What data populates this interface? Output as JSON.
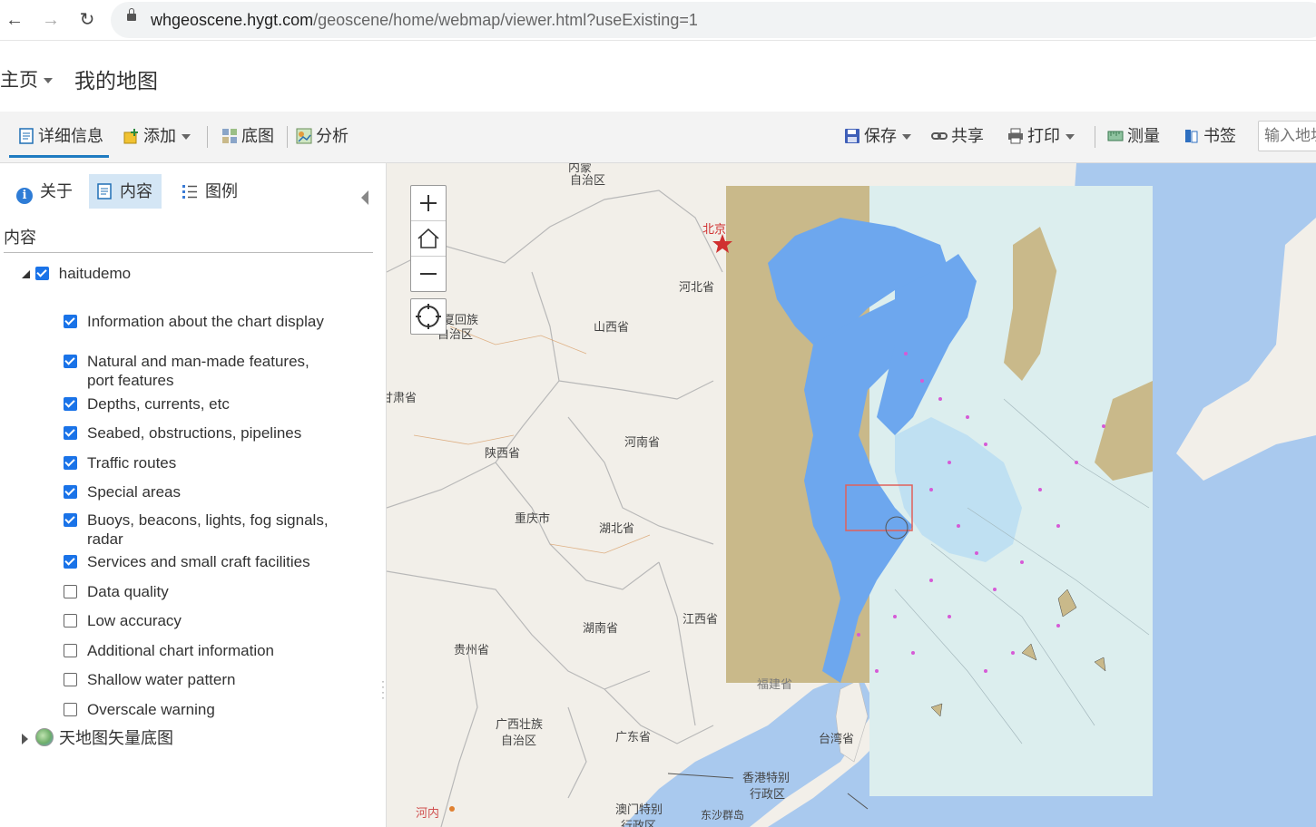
{
  "browser": {
    "url_host": "whgeoscene.hygt.com",
    "url_path": "/geoscene/home/webmap/viewer.html?useExisting=1"
  },
  "header": {
    "home_label": "主页",
    "map_title": "我的地图"
  },
  "toolbar": {
    "details": "详细信息",
    "add": "添加",
    "basemap": "底图",
    "analysis": "分析",
    "save": "保存",
    "share": "共享",
    "print": "打印",
    "measure": "测量",
    "bookmarks": "书签",
    "search_placeholder": "输入地址"
  },
  "panel": {
    "tab_about": "关于",
    "tab_content": "内容",
    "tab_legend": "图例",
    "content_heading": "内容",
    "root_layer": "haitudemo",
    "sublayers": [
      {
        "label": "Information about the chart display",
        "checked": true
      },
      {
        "label": "Natural and man-made features, port features",
        "checked": true
      },
      {
        "label": "Depths, currents, etc",
        "checked": true
      },
      {
        "label": "Seabed, obstructions, pipelines",
        "checked": true
      },
      {
        "label": "Traffic routes",
        "checked": true
      },
      {
        "label": "Special areas",
        "checked": true
      },
      {
        "label": "Buoys, beacons, lights, fog signals, radar",
        "checked": true
      },
      {
        "label": "Services and small craft facilities",
        "checked": true
      },
      {
        "label": "Data quality",
        "checked": false
      },
      {
        "label": "Low accuracy",
        "checked": false
      },
      {
        "label": "Additional chart information",
        "checked": false
      },
      {
        "label": "Shallow water pattern",
        "checked": false
      },
      {
        "label": "Overscale warning",
        "checked": false
      }
    ],
    "basemap_layer": "天地图矢量底图"
  },
  "map": {
    "labels": {
      "inner_mongolia": "自治区",
      "inner_mongolia_top": "内蒙",
      "beijing": "北京",
      "hebei": "河北省",
      "shanxi": "山西省",
      "ningxia_1": "夏回族",
      "ningxia_2": "自治区",
      "gansu": "甘肃省",
      "shaanxi": "陕西省",
      "henan": "河南省",
      "chongqing": "重庆市",
      "hubei": "湖北省",
      "hunan": "湖南省",
      "jiangxi": "江西省",
      "guizhou": "贵州省",
      "guangxi_1": "广西壮族",
      "guangxi_2": "自治区",
      "guangdong": "广东省",
      "taiwan": "台湾省",
      "hongkong_1": "香港特别",
      "hongkong_2": "行政区",
      "macau_1": "澳门特别",
      "macau_2": "行政区",
      "dongsha": "东沙群岛",
      "hanoi": "河内",
      "fujian": "福建省"
    },
    "colors": {
      "land": "#f2efe9",
      "sea": "#a9c9ee",
      "chart_land": "#c9b98a",
      "chart_water_shallow": "#6da7ee",
      "chart_water_deep": "#dceeee"
    }
  }
}
